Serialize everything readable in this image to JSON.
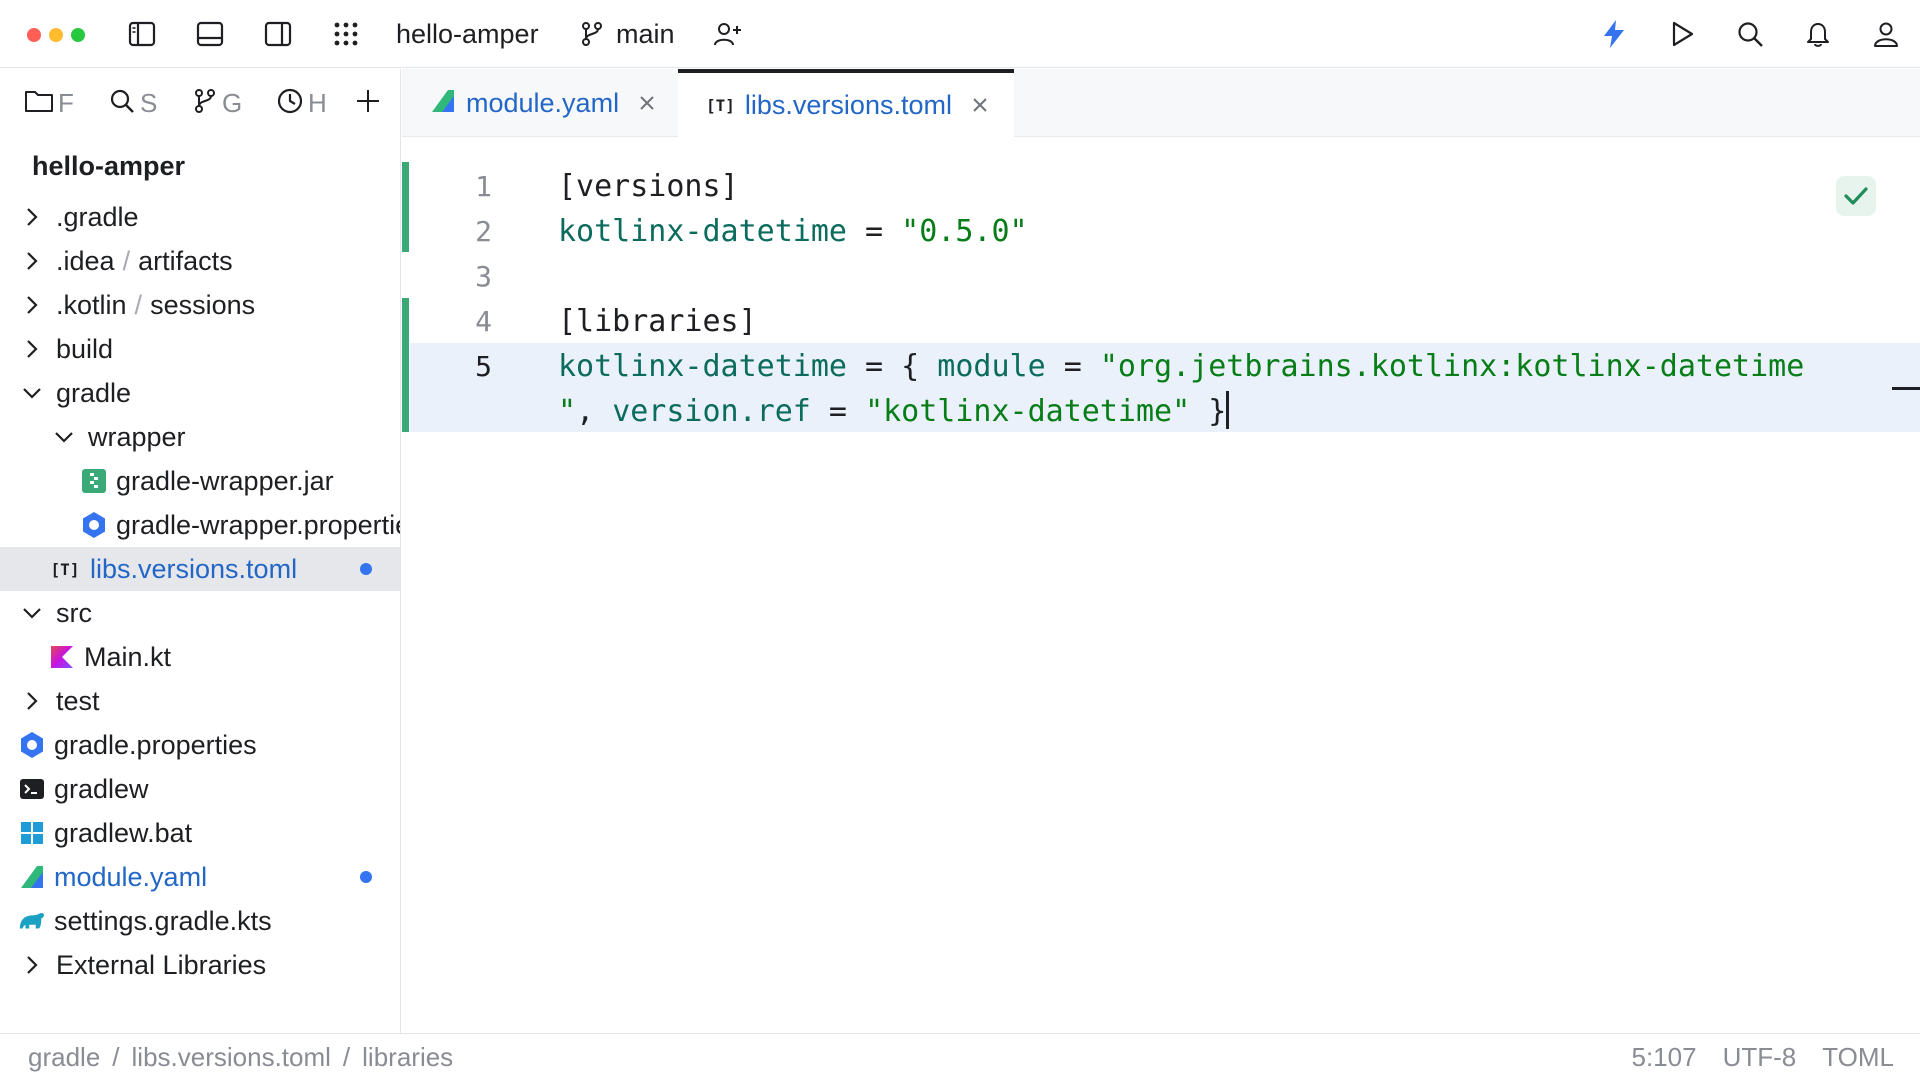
{
  "titlebar": {
    "project": "hello-amper",
    "branch": "main"
  },
  "sidebar": {
    "tabs": [
      {
        "label": "F",
        "icon": "folder-icon"
      },
      {
        "label": "S",
        "icon": "search-icon"
      },
      {
        "label": "G",
        "icon": "branch-icon"
      },
      {
        "label": "H",
        "icon": "clock-icon"
      }
    ],
    "project_title": "hello-amper",
    "tree": [
      {
        "name": ".gradle"
      },
      {
        "name": ".idea",
        "extra": "artifacts"
      },
      {
        "name": ".kotlin",
        "extra": "sessions"
      },
      {
        "name": "build"
      },
      {
        "name": "gradle"
      },
      {
        "name": "wrapper"
      },
      {
        "name": "gradle-wrapper.jar"
      },
      {
        "name": "gradle-wrapper.properties"
      },
      {
        "name": "libs.versions.toml"
      },
      {
        "name": "src"
      },
      {
        "name": "Main.kt"
      },
      {
        "name": "test"
      },
      {
        "name": "gradle.properties"
      },
      {
        "name": "gradlew"
      },
      {
        "name": "gradlew.bat"
      },
      {
        "name": "module.yaml"
      },
      {
        "name": "settings.gradle.kts"
      },
      {
        "name": "External Libraries"
      }
    ]
  },
  "tabs": [
    {
      "label": "module.yaml"
    },
    {
      "label": "libs.versions.toml"
    }
  ],
  "editor": {
    "toml_badge": "[T]",
    "line_numbers": [
      "1",
      "2",
      "3",
      "4",
      "5"
    ],
    "lines": {
      "l1": "[versions]",
      "l2_key": "kotlinx-datetime",
      "l2_eq": " = ",
      "l2_val": "\"0.5.0\"",
      "l4": "[libraries]",
      "l5_key": "kotlinx-datetime",
      "l5_mid": " = { ",
      "l5_module": "module",
      "l5_eq": " = ",
      "l5_val1": "\"org.jetbrains.kotlinx:kotlinx-datetime",
      "l5b_val1": "\"",
      "l5b_comma": ", ",
      "l5b_ref": "version.ref",
      "l5b_eq": " = ",
      "l5b_val2": "\"kotlinx-datetime\"",
      "l5b_end": " }"
    }
  },
  "statusbar": {
    "breadcrumbs": [
      "gradle",
      "libs.versions.toml",
      "libraries"
    ],
    "breadcrumb_sep": "/",
    "position": "5:107",
    "encoding": "UTF-8",
    "language": "TOML"
  },
  "colors": {
    "accent_blue": "#2266c6",
    "modified_dot": "#3574f0",
    "gutter_changed": "#3aa877",
    "string_green": "#067d17",
    "key_teal": "#0b6c5e",
    "current_line": "#eaf1fb"
  }
}
